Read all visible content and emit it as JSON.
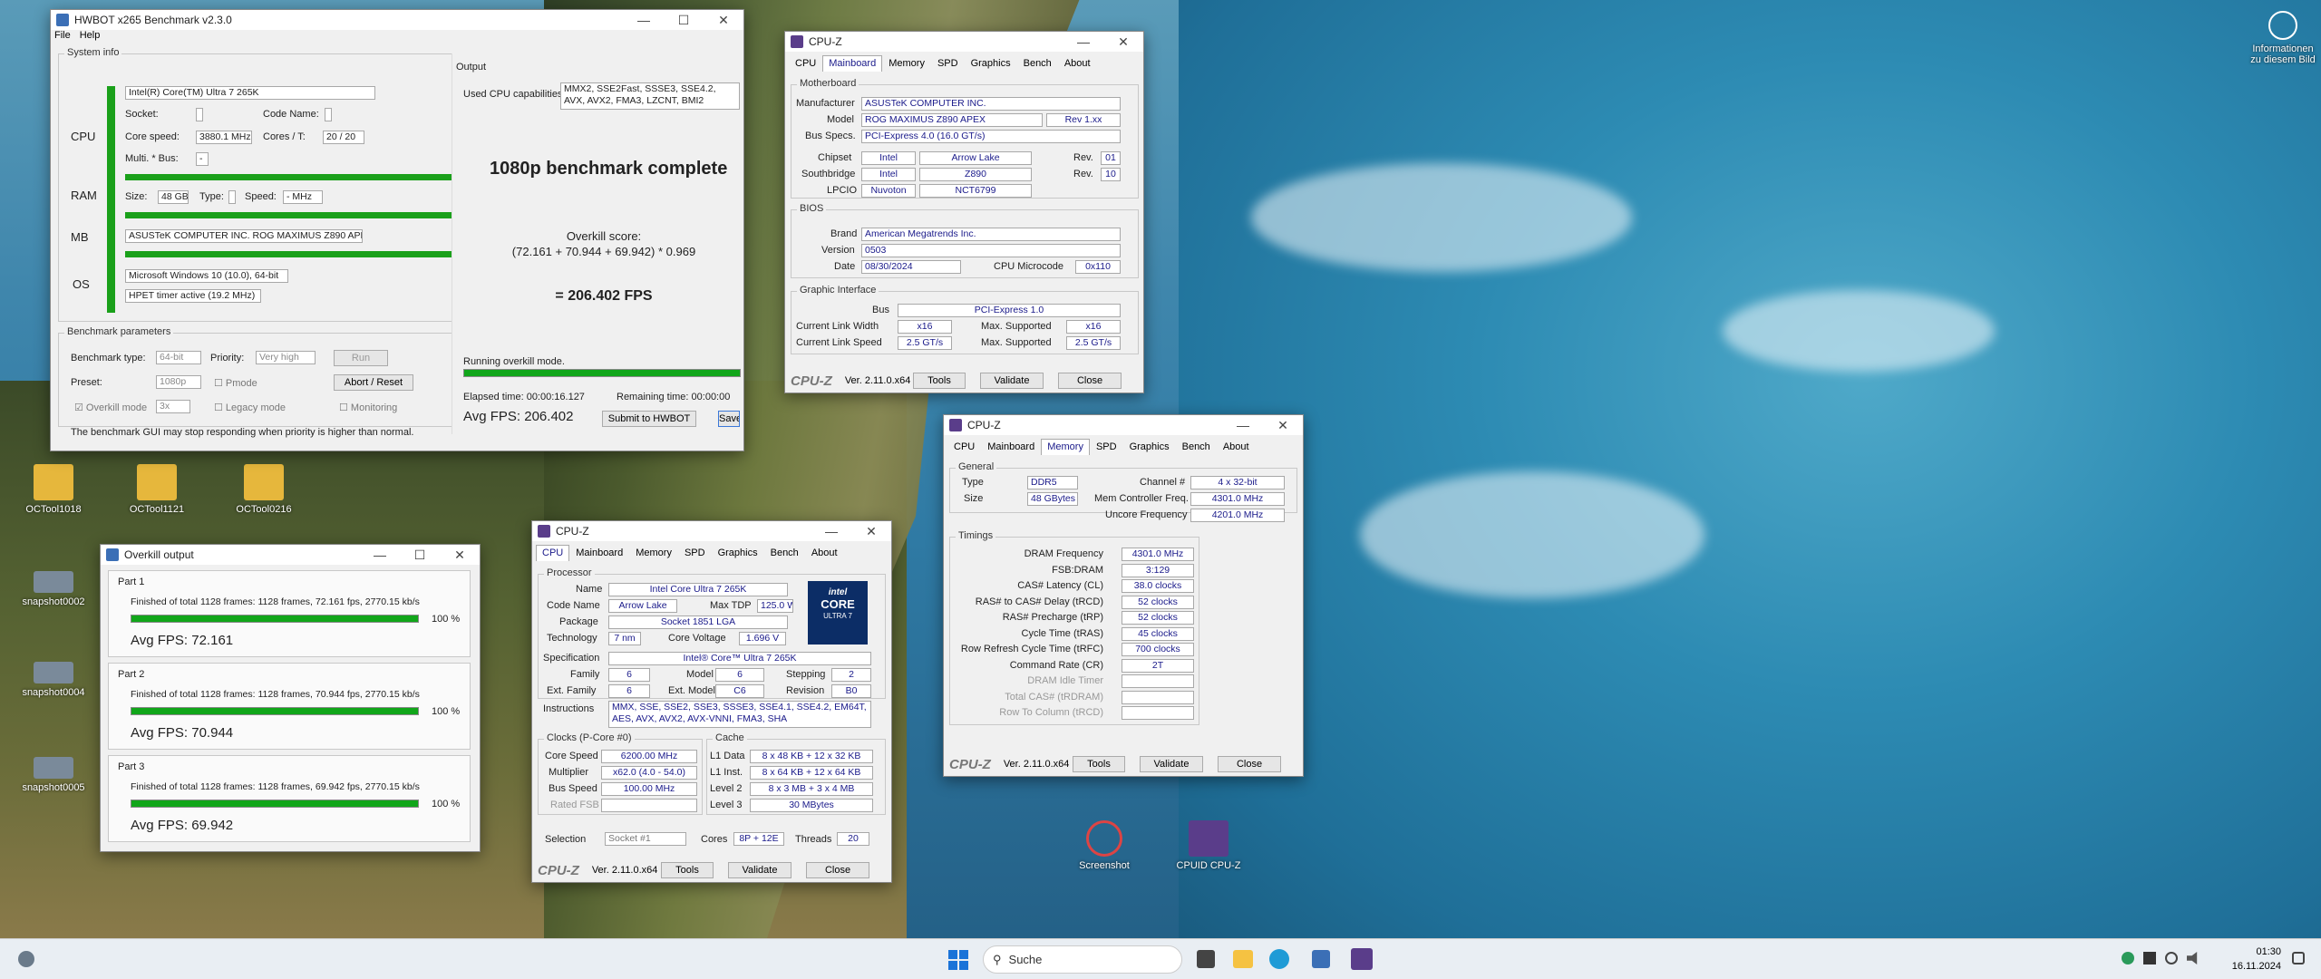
{
  "desktop": {
    "icons": [
      {
        "label": "OCTool1018",
        "color": "#e6b73c"
      },
      {
        "label": "OCTool1121",
        "color": "#e6b73c"
      },
      {
        "label": "OCTool0216",
        "color": "#e6b73c"
      },
      {
        "label": "snapshot0002",
        "color": "#7a8a9a"
      },
      {
        "label": "snapshot0004",
        "color": "#7a8a9a"
      },
      {
        "label": "snapshot0005",
        "color": "#7a8a9a"
      },
      {
        "label": "Screenshot",
        "color": "#d44"
      },
      {
        "label": "CPUID CPU-Z",
        "color": "#5a3d8a"
      }
    ],
    "corner_label": "Informationen zu diesem Bild"
  },
  "hwbot": {
    "title": "HWBOT x265 Benchmark v2.3.0",
    "menu": [
      "File",
      "Help"
    ],
    "sysinfo_title": "System info",
    "cpu_label": "CPU",
    "ram_label": "RAM",
    "mb_label": "MB",
    "os_label": "OS",
    "cpu_name": "Intel(R) Core(TM) Ultra 7 265K",
    "socket_label": "Socket:",
    "codename_label": "Code Name:",
    "corespeed_label": "Core speed:",
    "corespeed": "3880.1 MHz",
    "cores_label": "Cores / T:",
    "cores": "20 / 20",
    "multi_label": "Multi. * Bus:",
    "multi": "-",
    "size_label": "Size:",
    "size": "48 GB",
    "type_label": "Type:",
    "speed_label": "Speed:",
    "speed": "- MHz",
    "mb": "ASUSTeK COMPUTER INC. ROG MAXIMUS Z890 APEX",
    "os": "Microsoft Windows 10 (10.0), 64-bit",
    "timer": "HPET timer active (19.2 MHz)",
    "bp_title": "Benchmark parameters",
    "btype_label": "Benchmark type:",
    "btype": "64-bit",
    "priority_label": "Priority:",
    "priority": "Very high",
    "run": "Run",
    "preset_label": "Preset:",
    "preset": "1080p",
    "pmode": "Pmode",
    "abort": "Abort / Reset",
    "overkill_label": "Overkill mode",
    "overkill": "3x",
    "legacy": "Legacy mode",
    "monitoring": "Monitoring",
    "note": "The benchmark GUI may stop responding when priority is higher than normal.",
    "output_title": "Output",
    "cap_label": "Used CPU capabilities:",
    "caps": "MMX2, SSE2Fast, SSSE3, SSE4.2, AVX, AVX2, FMA3, LZCNT, BMI2",
    "headline": "1080p benchmark complete",
    "score_label": "Overkill score:",
    "formula": "(72.161 + 70.944 + 69.942) * 0.969",
    "result": "= 206.402 FPS",
    "running": "Running overkill mode.",
    "elapsed": "Elapsed time: 00:00:16.127",
    "remaining": "Remaining time: 00:00:00",
    "avg": "Avg FPS: 206.402",
    "submit": "Submit to HWBOT",
    "save": "Save",
    "progress": 1.0
  },
  "overkill": {
    "title": "Overkill output",
    "parts": [
      {
        "name": "Part 1",
        "line": "Finished of total 1128 frames: 1128 frames, 72.161 fps,  2770.15 kb/s",
        "pct": "100 %",
        "avg": "Avg FPS: 72.161"
      },
      {
        "name": "Part 2",
        "line": "Finished of total 1128 frames: 1128 frames, 70.944 fps,  2770.15 kb/s",
        "pct": "100 %",
        "avg": "Avg FPS: 70.944"
      },
      {
        "name": "Part 3",
        "line": "Finished of total 1128 frames: 1128 frames, 69.942 fps,  2770.15 kb/s",
        "pct": "100 %",
        "avg": "Avg FPS: 69.942"
      }
    ]
  },
  "cpuz_common": {
    "title": "CPU-Z",
    "tabs": [
      "CPU",
      "Mainboard",
      "Memory",
      "SPD",
      "Graphics",
      "Bench",
      "About"
    ],
    "logo": "CPU-Z",
    "version": "Ver. 2.11.0.x64",
    "tools": "Tools",
    "validate": "Validate",
    "close": "Close"
  },
  "cpuz_mb": {
    "motherboard": "Motherboard",
    "manufacturer_l": "Manufacturer",
    "manufacturer": "ASUSTeK COMPUTER INC.",
    "model_l": "Model",
    "model": "ROG MAXIMUS Z890 APEX",
    "rev": "Rev 1.xx",
    "busspecs_l": "Bus Specs.",
    "busspecs": "PCI-Express 4.0 (16.0 GT/s)",
    "chipset_l": "Chipset",
    "chipset": "Intel",
    "chipset2": "Arrow Lake",
    "rev_l": "Rev.",
    "chipset_rev": "01",
    "sb_l": "Southbridge",
    "sb": "Intel",
    "sb2": "Z890",
    "sb_rev": "10",
    "lpcio_l": "LPCIO",
    "lpcio": "Nuvoton",
    "lpcio2": "NCT6799",
    "bios": "BIOS",
    "brand_l": "Brand",
    "brand": "American Megatrends Inc.",
    "version_l": "Version",
    "version": "0503",
    "date_l": "Date",
    "date": "08/30/2024",
    "microcode_l": "CPU Microcode",
    "microcode": "0x110",
    "gi": "Graphic Interface",
    "bus_l": "Bus",
    "bus": "PCI-Express 1.0",
    "clw_l": "Current Link Width",
    "clw": "x16",
    "msw_l": "Max. Supported",
    "msw": "x16",
    "cls_l": "Current Link Speed",
    "cls": "2.5 GT/s",
    "mss": "2.5 GT/s"
  },
  "cpuz_mem": {
    "general": "General",
    "type_l": "Type",
    "type": "DDR5",
    "channel_l": "Channel #",
    "channel": "4 x 32-bit",
    "size_l": "Size",
    "size": "48 GBytes",
    "mcf_l": "Mem Controller Freq.",
    "mcf": "4301.0 MHz",
    "ucf_l": "Uncore Frequency",
    "ucf": "4201.0 MHz",
    "timings": "Timings",
    "rows": [
      {
        "l": "DRAM Frequency",
        "v": "4301.0 MHz"
      },
      {
        "l": "FSB:DRAM",
        "v": "3:129"
      },
      {
        "l": "CAS# Latency (CL)",
        "v": "38.0 clocks"
      },
      {
        "l": "RAS# to CAS# Delay (tRCD)",
        "v": "52 clocks"
      },
      {
        "l": "RAS# Precharge (tRP)",
        "v": "52 clocks"
      },
      {
        "l": "Cycle Time (tRAS)",
        "v": "45 clocks"
      },
      {
        "l": "Row Refresh Cycle Time (tRFC)",
        "v": "700 clocks"
      },
      {
        "l": "Command Rate (CR)",
        "v": "2T"
      },
      {
        "l": "DRAM Idle Timer",
        "v": ""
      },
      {
        "l": "Total CAS# (tRDRAM)",
        "v": ""
      },
      {
        "l": "Row To Column (tRCD)",
        "v": ""
      }
    ]
  },
  "cpuz_cpu": {
    "processor": "Processor",
    "name_l": "Name",
    "name": "Intel Core Ultra 7 265K",
    "codename_l": "Code Name",
    "codename": "Arrow Lake",
    "tdp_l": "Max TDP",
    "tdp": "125.0 W",
    "package_l": "Package",
    "package": "Socket 1851 LGA",
    "tech_l": "Technology",
    "tech": "7 nm",
    "cv_l": "Core Voltage",
    "cv": "1.696 V",
    "spec_l": "Specification",
    "spec": "Intel® Core™ Ultra 7 265K",
    "family_l": "Family",
    "family": "6",
    "model_l": "Model",
    "model": "6",
    "stepping_l": "Stepping",
    "stepping": "2",
    "extfam_l": "Ext. Family",
    "extfam": "6",
    "extmodel_l": "Ext. Model",
    "extmodel": "C6",
    "revision_l": "Revision",
    "revision": "B0",
    "instr_l": "Instructions",
    "instr": "MMX, SSE, SSE2, SSE3, SSSE3, SSE4.1, SSE4.2, EM64T, AES, AVX, AVX2, AVX-VNNI, FMA3, SHA",
    "clocks": "Clocks (P-Core #0)",
    "cs_l": "Core Speed",
    "cs": "6200.00 MHz",
    "mult_l": "Multiplier",
    "mult": "x62.0 (4.0 - 54.0)",
    "bs_l": "Bus Speed",
    "bs": "100.00 MHz",
    "rfsb_l": "Rated FSB",
    "cache": "Cache",
    "l1d_l": "L1 Data",
    "l1d": "8 x 48 KB + 12 x 32 KB",
    "l1i_l": "L1 Inst.",
    "l1i": "8 x 64 KB + 12 x 64 KB",
    "l2_l": "Level 2",
    "l2": "8 x 3 MB + 3 x 4 MB",
    "l3_l": "Level 3",
    "l3": "30 MBytes",
    "sel_l": "Selection",
    "sel": "Socket #1",
    "cores_l": "Cores",
    "cores": "8P + 12E",
    "threads_l": "Threads",
    "threads": "20",
    "badge1": "intel",
    "badge2": "CORE",
    "badge3": "ULTRA 7"
  },
  "taskbar": {
    "search": "Suche",
    "time": "01:30",
    "date": "16.11.2024"
  }
}
